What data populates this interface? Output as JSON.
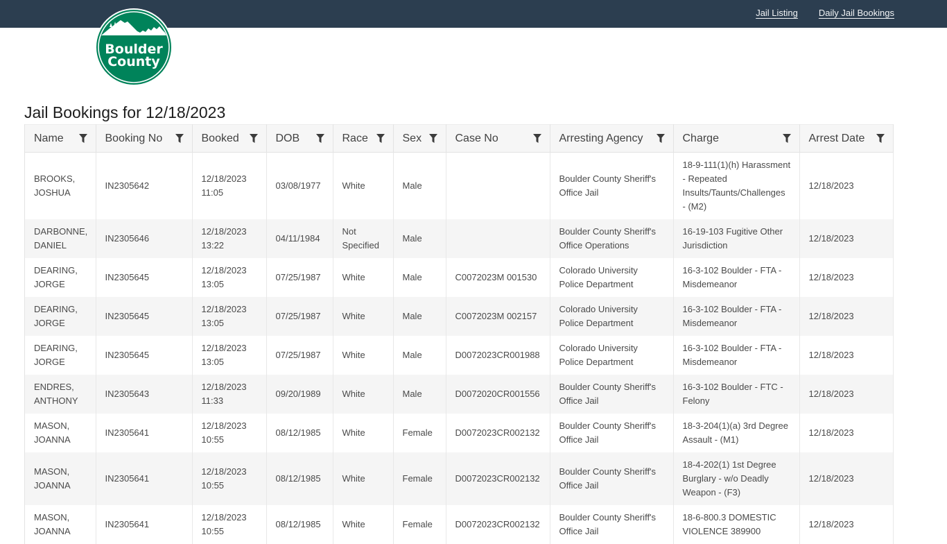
{
  "nav": {
    "links": [
      {
        "label": "Jail Listing"
      },
      {
        "label": "Daily Jail Bookings"
      }
    ]
  },
  "logo": {
    "line1": "Boulder",
    "line2": "County",
    "color": "#00835a"
  },
  "page": {
    "title": "Jail Bookings for 12/18/2023"
  },
  "table": {
    "columns": [
      {
        "label": "Name",
        "icon": "filter-icon"
      },
      {
        "label": "Booking No",
        "icon": "filter-icon"
      },
      {
        "label": "Booked",
        "icon": "filter-icon"
      },
      {
        "label": "DOB",
        "icon": "filter-icon"
      },
      {
        "label": "Race",
        "icon": "filter-icon"
      },
      {
        "label": "Sex",
        "icon": "filter-icon"
      },
      {
        "label": "Case No",
        "icon": "filter-icon"
      },
      {
        "label": "Arresting Agency",
        "icon": "filter-icon"
      },
      {
        "label": "Charge",
        "icon": "filter-icon"
      },
      {
        "label": "Arrest Date",
        "icon": "filter-icon"
      }
    ],
    "rows": [
      {
        "name": "BROOKS, JOSHUA",
        "booking_no": "IN2305642",
        "booked": "12/18/2023 11:05",
        "dob": "03/08/1977",
        "race": "White",
        "sex": "Male",
        "case_no": "",
        "agency": "Boulder County Sheriff's Office Jail",
        "charge": "18-9-111(1)(h) Harassment - Repeated Insults/Taunts/Challenges - (M2)",
        "arrest_date": "12/18/2023"
      },
      {
        "name": "DARBONNE, DANIEL",
        "booking_no": "IN2305646",
        "booked": "12/18/2023 13:22",
        "dob": "04/11/1984",
        "race": "Not Specified",
        "sex": "Male",
        "case_no": "",
        "agency": "Boulder County Sheriff's Office Operations",
        "charge": "16-19-103 Fugitive Other Jurisdiction",
        "arrest_date": "12/18/2023"
      },
      {
        "name": "DEARING, JORGE",
        "booking_no": "IN2305645",
        "booked": "12/18/2023 13:05",
        "dob": "07/25/1987",
        "race": "White",
        "sex": "Male",
        "case_no": "C0072023M 001530",
        "agency": "Colorado University Police Department",
        "charge": "16-3-102 Boulder - FTA - Misdemeanor",
        "arrest_date": "12/18/2023"
      },
      {
        "name": "DEARING, JORGE",
        "booking_no": "IN2305645",
        "booked": "12/18/2023 13:05",
        "dob": "07/25/1987",
        "race": "White",
        "sex": "Male",
        "case_no": "C0072023M 002157",
        "agency": "Colorado University Police Department",
        "charge": "16-3-102 Boulder - FTA - Misdemeanor",
        "arrest_date": "12/18/2023"
      },
      {
        "name": "DEARING, JORGE",
        "booking_no": "IN2305645",
        "booked": "12/18/2023 13:05",
        "dob": "07/25/1987",
        "race": "White",
        "sex": "Male",
        "case_no": "D0072023CR001988",
        "agency": "Colorado University Police Department",
        "charge": "16-3-102 Boulder - FTA - Misdemeanor",
        "arrest_date": "12/18/2023"
      },
      {
        "name": "ENDRES, ANTHONY",
        "booking_no": "IN2305643",
        "booked": "12/18/2023 11:33",
        "dob": "09/20/1989",
        "race": "White",
        "sex": "Male",
        "case_no": "D0072020CR001556",
        "agency": "Boulder County Sheriff's Office Jail",
        "charge": "16-3-102 Boulder - FTC - Felony",
        "arrest_date": "12/18/2023"
      },
      {
        "name": "MASON, JOANNA",
        "booking_no": "IN2305641",
        "booked": "12/18/2023 10:55",
        "dob": "08/12/1985",
        "race": "White",
        "sex": "Female",
        "case_no": "D0072023CR002132",
        "agency": "Boulder County Sheriff's Office Jail",
        "charge": "18-3-204(1)(a) 3rd Degree Assault - (M1)",
        "arrest_date": "12/18/2023"
      },
      {
        "name": "MASON, JOANNA",
        "booking_no": "IN2305641",
        "booked": "12/18/2023 10:55",
        "dob": "08/12/1985",
        "race": "White",
        "sex": "Female",
        "case_no": "D0072023CR002132",
        "agency": "Boulder County Sheriff's Office Jail",
        "charge": "18-4-202(1) 1st Degree Burglary - w/o Deadly Weapon - (F3)",
        "arrest_date": "12/18/2023"
      },
      {
        "name": "MASON, JOANNA",
        "booking_no": "IN2305641",
        "booked": "12/18/2023 10:55",
        "dob": "08/12/1985",
        "race": "White",
        "sex": "Female",
        "case_no": "D0072023CR002132",
        "agency": "Boulder County Sheriff's Office Jail",
        "charge": "18-6-800.3 DOMESTIC VIOLENCE 389900",
        "arrest_date": "12/18/2023"
      }
    ]
  }
}
